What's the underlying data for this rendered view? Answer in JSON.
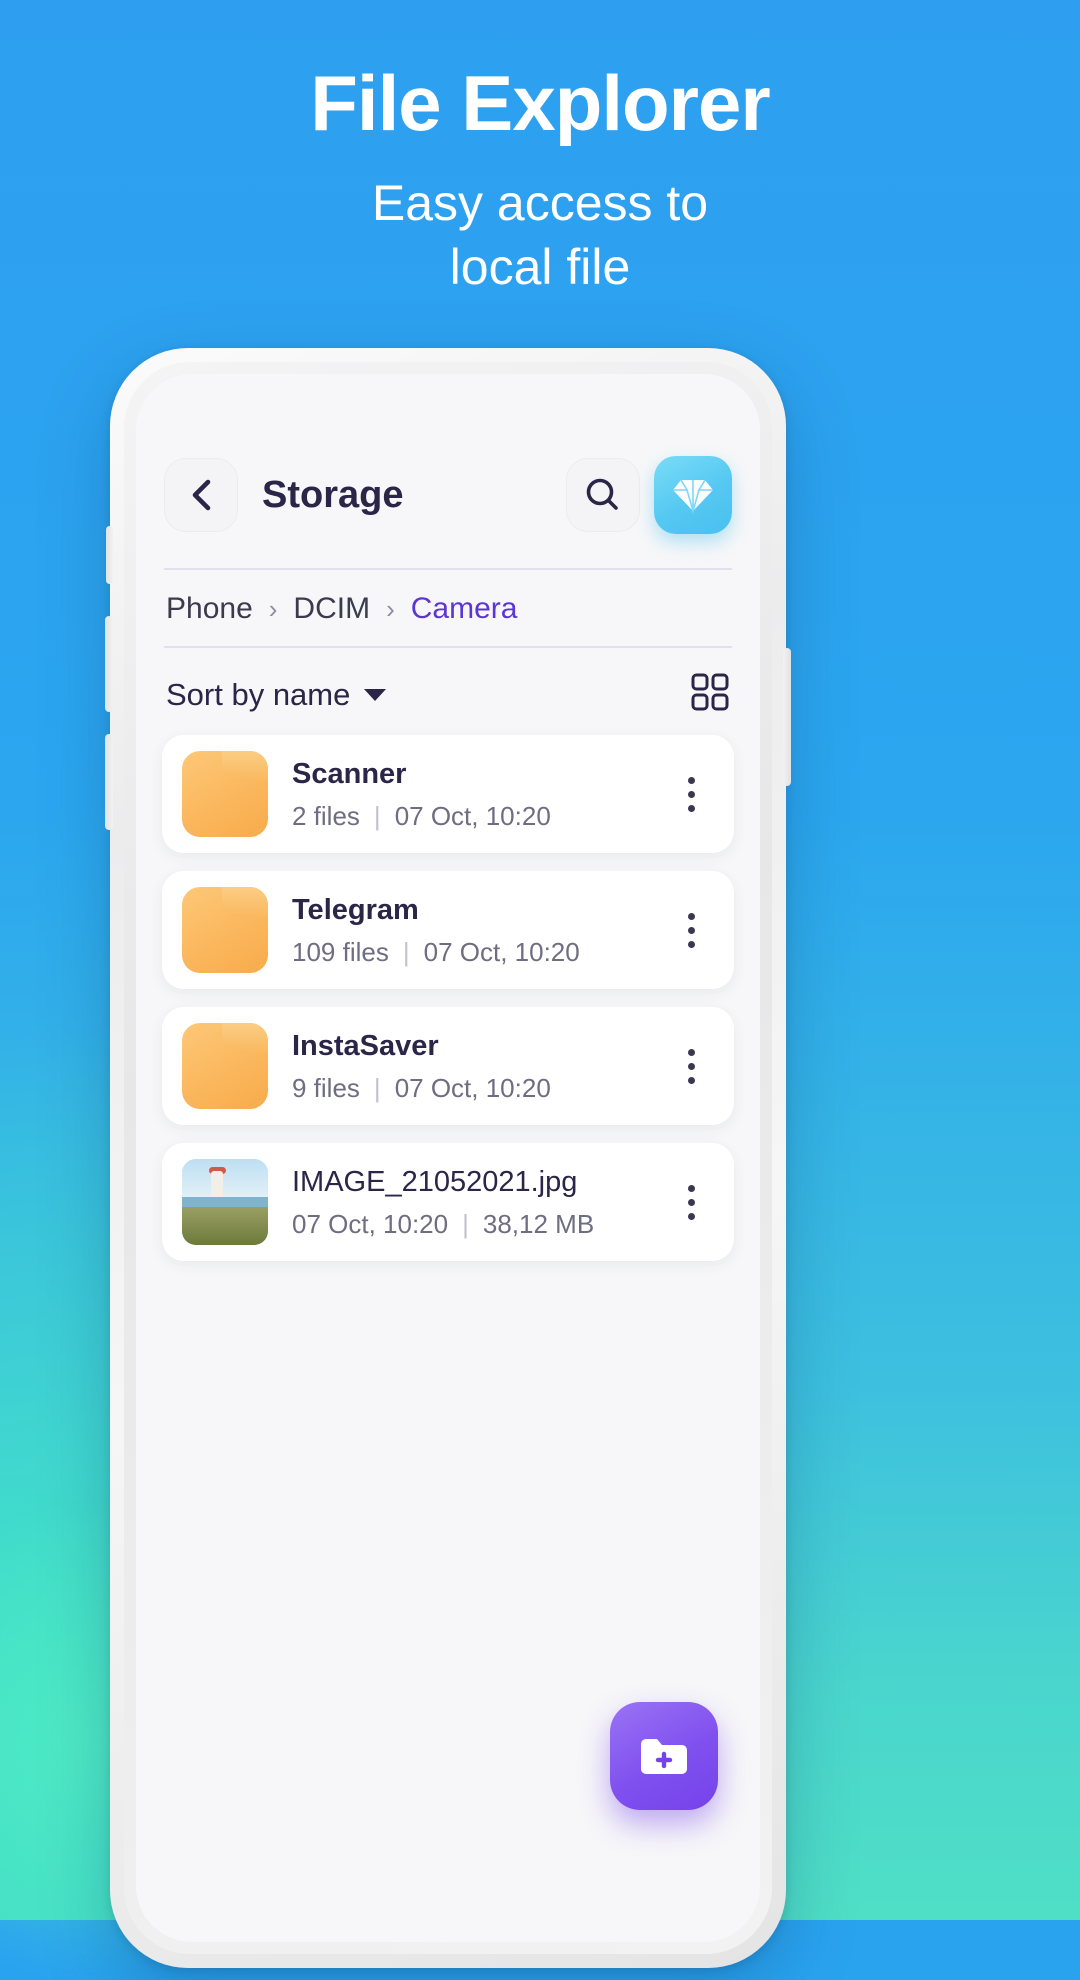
{
  "promo": {
    "title": "File Explorer",
    "subtitle_line1": "Easy access to",
    "subtitle_line2": "local file",
    "bg_color": "#2aa3ef",
    "accent_color": "#4fdfc6"
  },
  "app": {
    "header": {
      "back_icon": "chevron-left-icon",
      "title": "Storage",
      "search_icon": "search-icon",
      "premium_icon": "diamond-icon",
      "premium_color": "#49c0ef"
    },
    "breadcrumb": {
      "items": [
        {
          "label": "Phone",
          "current": false
        },
        {
          "label": "DCIM",
          "current": false
        },
        {
          "label": "Camera",
          "current": true
        }
      ],
      "separator": "›",
      "current_color": "#5b35d5"
    },
    "toolbar": {
      "sort_label": "Sort by name",
      "sort_caret_icon": "caret-down-icon",
      "view_toggle_icon": "grid-view-icon"
    },
    "list": {
      "items": [
        {
          "name": "Scanner",
          "type": "folder",
          "icon": "folder-icon",
          "count": "2 files",
          "divider": "|",
          "date": "07 Oct, 10:20",
          "size": "",
          "menu_icon": "more-vertical-icon"
        },
        {
          "name": "Telegram",
          "type": "folder",
          "icon": "folder-icon",
          "count": "109 files",
          "divider": "|",
          "date": "07 Oct, 10:20",
          "size": "",
          "menu_icon": "more-vertical-icon"
        },
        {
          "name": "InstaSaver",
          "type": "folder",
          "icon": "folder-icon",
          "count": "9 files",
          "divider": "|",
          "date": "07 Oct, 10:20",
          "size": "",
          "menu_icon": "more-vertical-icon"
        },
        {
          "name": "IMAGE_21052021.jpg",
          "type": "image",
          "icon": "photo-thumbnail",
          "count": "07 Oct, 10:20",
          "divider": "|",
          "date": "38,12 MB",
          "size": "38,12 MB",
          "menu_icon": "more-vertical-icon"
        }
      ]
    },
    "fab": {
      "icon": "folder-plus-icon",
      "color": "#7542ea"
    }
  }
}
